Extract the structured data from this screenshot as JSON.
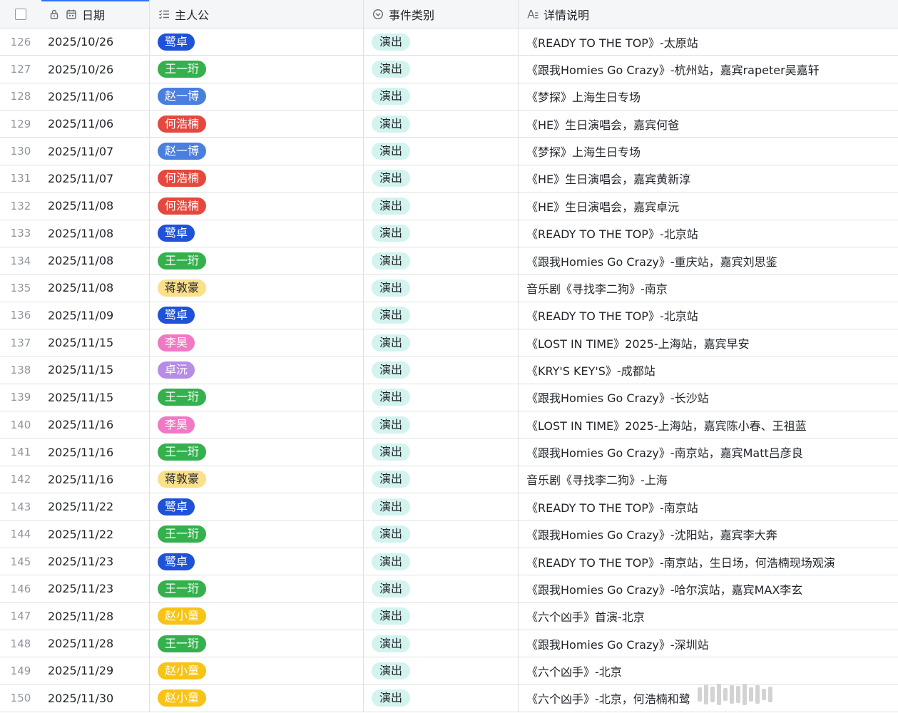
{
  "header": {
    "date_label": "日期",
    "protagonist_label": "主人公",
    "type_label": "事件类别",
    "desc_label": "详情说明"
  },
  "protagonist_colors": {
    "鹭卓": {
      "bg": "#1e52d8",
      "fg": "#ffffff"
    },
    "王一珩": {
      "bg": "#34b14d",
      "fg": "#ffffff"
    },
    "赵一博": {
      "bg": "#4a7fe0",
      "fg": "#ffffff"
    },
    "何浩楠": {
      "bg": "#e5483e",
      "fg": "#ffffff"
    },
    "蒋敦豪": {
      "bg": "#fbe08a",
      "fg": "#1f2329"
    },
    "李昊": {
      "bg": "#ef79c2",
      "fg": "#ffffff"
    },
    "卓沅": {
      "bg": "#b78be6",
      "fg": "#ffffff"
    },
    "赵小童": {
      "bg": "#f7c314",
      "fg": "#ffffff"
    }
  },
  "rows": [
    {
      "idx": "126",
      "date": "2025/10/26",
      "protagonist": "鹭卓",
      "type": "演出",
      "desc": "《READY TO THE TOP》-太原站"
    },
    {
      "idx": "127",
      "date": "2025/10/26",
      "protagonist": "王一珩",
      "type": "演出",
      "desc": "《跟我Homies Go Crazy》-杭州站，嘉宾rapeter吴嘉轩"
    },
    {
      "idx": "128",
      "date": "2025/11/06",
      "protagonist": "赵一博",
      "type": "演出",
      "desc": "《梦探》上海生日专场"
    },
    {
      "idx": "129",
      "date": "2025/11/06",
      "protagonist": "何浩楠",
      "type": "演出",
      "desc": "《HE》生日演唱会，嘉宾何爸"
    },
    {
      "idx": "130",
      "date": "2025/11/07",
      "protagonist": "赵一博",
      "type": "演出",
      "desc": "《梦探》上海生日专场"
    },
    {
      "idx": "131",
      "date": "2025/11/07",
      "protagonist": "何浩楠",
      "type": "演出",
      "desc": "《HE》生日演唱会，嘉宾黄新淳"
    },
    {
      "idx": "132",
      "date": "2025/11/08",
      "protagonist": "何浩楠",
      "type": "演出",
      "desc": "《HE》生日演唱会，嘉宾卓沅"
    },
    {
      "idx": "133",
      "date": "2025/11/08",
      "protagonist": "鹭卓",
      "type": "演出",
      "desc": "《READY TO THE TOP》-北京站"
    },
    {
      "idx": "134",
      "date": "2025/11/08",
      "protagonist": "王一珩",
      "type": "演出",
      "desc": "《跟我Homies Go Crazy》-重庆站，嘉宾刘思鉴"
    },
    {
      "idx": "135",
      "date": "2025/11/08",
      "protagonist": "蒋敦豪",
      "type": "演出",
      "desc": "音乐剧《寻找李二狗》-南京"
    },
    {
      "idx": "136",
      "date": "2025/11/09",
      "protagonist": "鹭卓",
      "type": "演出",
      "desc": "《READY TO THE TOP》-北京站"
    },
    {
      "idx": "137",
      "date": "2025/11/15",
      "protagonist": "李昊",
      "type": "演出",
      "desc": "《LOST IN TIME》2025-上海站，嘉宾早安"
    },
    {
      "idx": "138",
      "date": "2025/11/15",
      "protagonist": "卓沅",
      "type": "演出",
      "desc": "《KRY'S KEY'S》-成都站"
    },
    {
      "idx": "139",
      "date": "2025/11/15",
      "protagonist": "王一珩",
      "type": "演出",
      "desc": "《跟我Homies Go Crazy》-长沙站"
    },
    {
      "idx": "140",
      "date": "2025/11/16",
      "protagonist": "李昊",
      "type": "演出",
      "desc": "《LOST IN TIME》2025-上海站，嘉宾陈小春、王祖蓝"
    },
    {
      "idx": "141",
      "date": "2025/11/16",
      "protagonist": "王一珩",
      "type": "演出",
      "desc": "《跟我Homies Go Crazy》-南京站，嘉宾Matt吕彦良"
    },
    {
      "idx": "142",
      "date": "2025/11/16",
      "protagonist": "蒋敦豪",
      "type": "演出",
      "desc": "音乐剧《寻找李二狗》-上海"
    },
    {
      "idx": "143",
      "date": "2025/11/22",
      "protagonist": "鹭卓",
      "type": "演出",
      "desc": "《READY TO THE TOP》-南京站"
    },
    {
      "idx": "144",
      "date": "2025/11/22",
      "protagonist": "王一珩",
      "type": "演出",
      "desc": "《跟我Homies Go Crazy》-沈阳站，嘉宾李大奔"
    },
    {
      "idx": "145",
      "date": "2025/11/23",
      "protagonist": "鹭卓",
      "type": "演出",
      "desc": "《READY TO THE TOP》-南京站，生日场，何浩楠现场观演"
    },
    {
      "idx": "146",
      "date": "2025/11/23",
      "protagonist": "王一珩",
      "type": "演出",
      "desc": "《跟我Homies Go Crazy》-哈尔滨站，嘉宾MAX李玄"
    },
    {
      "idx": "147",
      "date": "2025/11/28",
      "protagonist": "赵小童",
      "type": "演出",
      "desc": "《六个凶手》首演-北京"
    },
    {
      "idx": "148",
      "date": "2025/11/28",
      "protagonist": "王一珩",
      "type": "演出",
      "desc": "《跟我Homies Go Crazy》-深圳站"
    },
    {
      "idx": "149",
      "date": "2025/11/29",
      "protagonist": "赵小童",
      "type": "演出",
      "desc": "《六个凶手》-北京"
    },
    {
      "idx": "150",
      "date": "2025/11/30",
      "protagonist": "赵小童",
      "type": "演出",
      "desc": "《六个凶手》-北京，何浩楠和鹭"
    }
  ]
}
